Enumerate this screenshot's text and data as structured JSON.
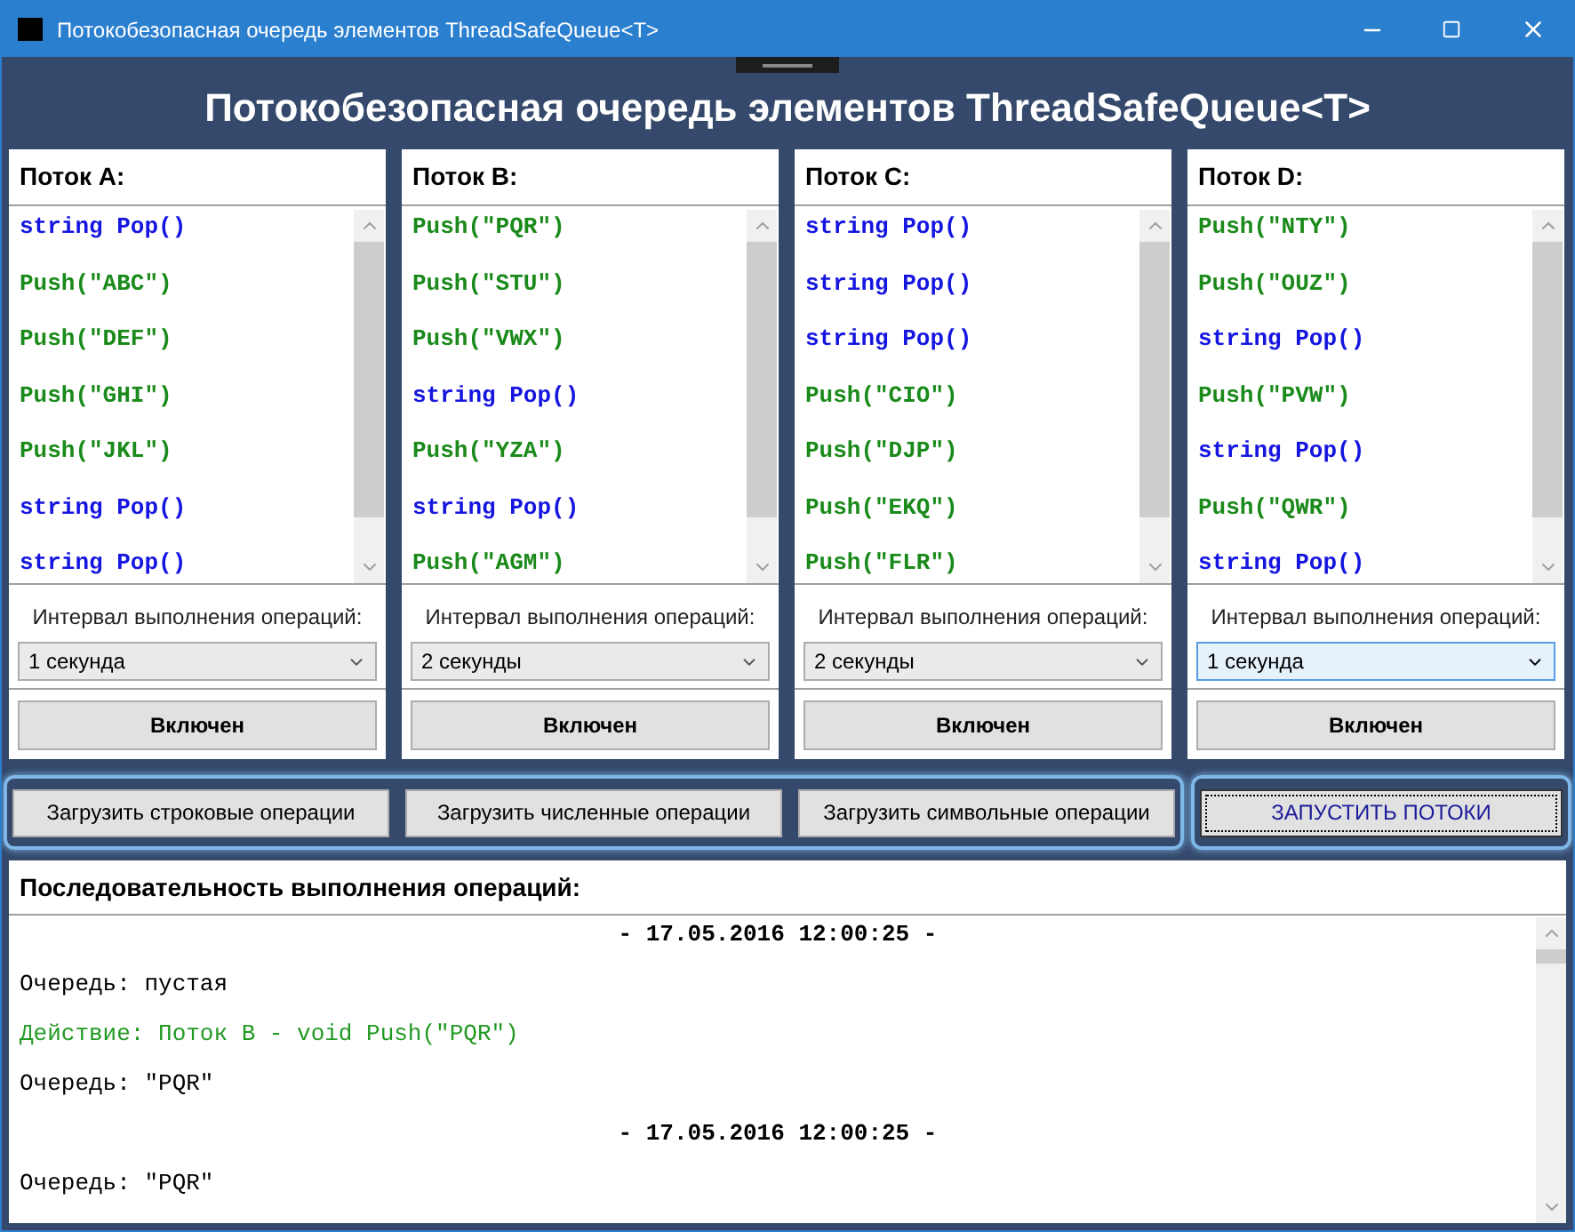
{
  "window": {
    "title": "Потокобезопасная очередь элементов ThreadSafeQueue<T>"
  },
  "heading": "Потокобезопасная очередь элементов ThreadSafeQueue<T>",
  "threads": [
    {
      "title": "Поток A:",
      "operations": [
        {
          "kind": "pop",
          "text": "string Pop()"
        },
        {
          "kind": "push",
          "text": "Push(\"ABC\")"
        },
        {
          "kind": "push",
          "text": "Push(\"DEF\")"
        },
        {
          "kind": "push",
          "text": "Push(\"GHI\")"
        },
        {
          "kind": "push",
          "text": "Push(\"JKL\")"
        },
        {
          "kind": "pop",
          "text": "string Pop()"
        },
        {
          "kind": "pop",
          "text": "string Pop()"
        }
      ],
      "interval_label": "Интервал выполнения операций:",
      "interval": {
        "value": "1 секунда",
        "focused": false
      },
      "toggle": "Включен"
    },
    {
      "title": "Поток B:",
      "operations": [
        {
          "kind": "push",
          "text": "Push(\"PQR\")"
        },
        {
          "kind": "push",
          "text": "Push(\"STU\")"
        },
        {
          "kind": "push",
          "text": "Push(\"VWX\")"
        },
        {
          "kind": "pop",
          "text": "string Pop()"
        },
        {
          "kind": "push",
          "text": "Push(\"YZA\")"
        },
        {
          "kind": "pop",
          "text": "string Pop()"
        },
        {
          "kind": "push",
          "text": "Push(\"AGM\")"
        }
      ],
      "interval_label": "Интервал выполнения операций:",
      "interval": {
        "value": "2 секунды",
        "focused": false
      },
      "toggle": "Включен"
    },
    {
      "title": "Поток C:",
      "operations": [
        {
          "kind": "pop",
          "text": "string Pop()"
        },
        {
          "kind": "pop",
          "text": "string Pop()"
        },
        {
          "kind": "pop",
          "text": "string Pop()"
        },
        {
          "kind": "push",
          "text": "Push(\"CIO\")"
        },
        {
          "kind": "push",
          "text": "Push(\"DJP\")"
        },
        {
          "kind": "push",
          "text": "Push(\"EKQ\")"
        },
        {
          "kind": "push",
          "text": "Push(\"FLR\")"
        }
      ],
      "interval_label": "Интервал выполнения операций:",
      "interval": {
        "value": "2 секунды",
        "focused": false
      },
      "toggle": "Включен"
    },
    {
      "title": "Поток D:",
      "operations": [
        {
          "kind": "push",
          "text": "Push(\"NTY\")"
        },
        {
          "kind": "push",
          "text": "Push(\"OUZ\")"
        },
        {
          "kind": "pop",
          "text": "string Pop()"
        },
        {
          "kind": "push",
          "text": "Push(\"PVW\")"
        },
        {
          "kind": "pop",
          "text": "string Pop()"
        },
        {
          "kind": "push",
          "text": "Push(\"QWR\")"
        },
        {
          "kind": "pop",
          "text": "string Pop()"
        }
      ],
      "interval_label": "Интервал выполнения операций:",
      "interval": {
        "value": "1 секунда",
        "focused": true
      },
      "toggle": "Включен"
    }
  ],
  "load_buttons": [
    "Загрузить строковые операции",
    "Загрузить численные операции",
    "Загрузить символьные операции"
  ],
  "start_button": "ЗАПУСТИТЬ ПОТОКИ",
  "log": {
    "title": "Последовательность выполнения операций:",
    "lines": [
      {
        "kind": "timestamp",
        "text": "- 17.05.2016 12:00:25 -"
      },
      {
        "kind": "queue",
        "text": "Очередь: пустая"
      },
      {
        "kind": "action",
        "text": "Действие: Поток B - void Push(\"PQR\")"
      },
      {
        "kind": "queue",
        "text": "Очередь: \"PQR\""
      },
      {
        "kind": "timestamp",
        "text": "- 17.05.2016 12:00:25 -"
      },
      {
        "kind": "queue",
        "text": "Очередь: \"PQR\""
      }
    ]
  }
}
